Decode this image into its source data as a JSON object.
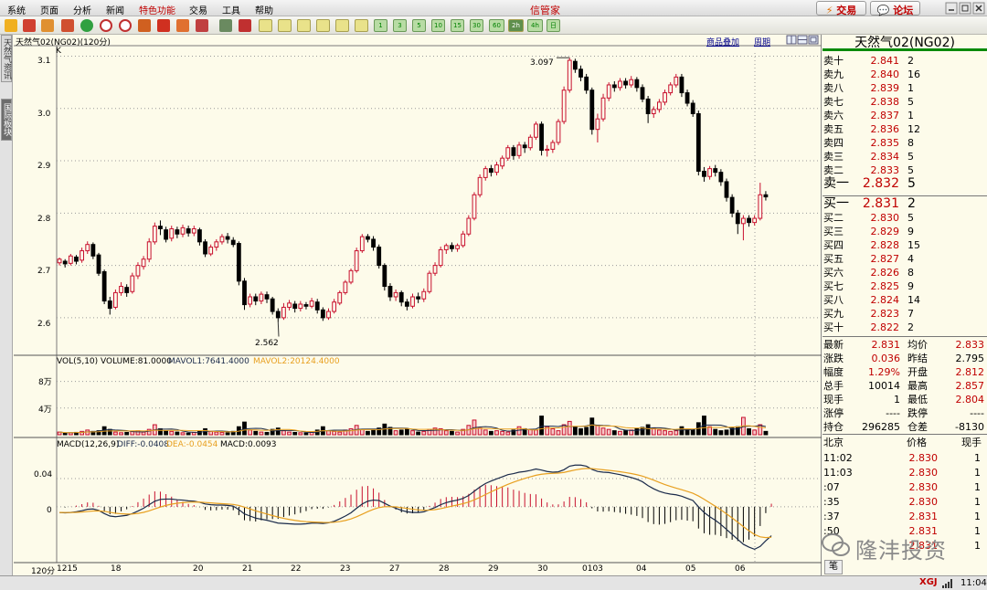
{
  "menu": {
    "items": [
      "系统",
      "页面",
      "分析",
      "新闻",
      "特色功能",
      "交易",
      "工具",
      "帮助"
    ],
    "special_index": 4
  },
  "app_title": "信管家",
  "trade_button": "交易",
  "forum_button": "论坛",
  "toolbar": {
    "periods": [
      "1",
      "3",
      "5",
      "10",
      "15",
      "30",
      "60",
      "2h",
      "4h",
      "日"
    ],
    "active_period": "2h"
  },
  "left_tabs": [
    "天然气资讯",
    "国际板块"
  ],
  "chart_header": {
    "title": "天然气02(NG02)(120分)",
    "overlay_button": "商品叠加",
    "period_button": "周期"
  },
  "main_chart": {
    "kline_label": "K",
    "yticks": [
      "3.1",
      "3.0",
      "2.9",
      "2.8",
      "2.7",
      "2.6"
    ],
    "high_label": "3.097",
    "low_label": "2.562"
  },
  "volume_panel": {
    "label": "VOL(5,10)",
    "volume": "VOLUME:81.0000",
    "mavol1": "MAVOL1:7641.4000",
    "mavol2": "MAVOL2:20124.4000",
    "yticks": [
      "8万",
      "4万"
    ]
  },
  "macd_panel": {
    "label": "MACD(12,26,9)",
    "diff": "DIFF:-0.0408",
    "dea": "DEA:-0.0454",
    "macd": "MACD:0.0093",
    "yticks": [
      "0.04",
      "0"
    ]
  },
  "xaxis": {
    "period_label": "120分",
    "dates": [
      "1215",
      "18",
      "20",
      "21",
      "22",
      "23",
      "27",
      "28",
      "29",
      "30",
      "0103",
      "04",
      "05",
      "06"
    ]
  },
  "chart_data": {
    "type": "candlestick",
    "ylim": [
      2.53,
      3.12
    ],
    "candles": [
      [
        2.705,
        2.712,
        2.7,
        2.715
      ],
      [
        2.708,
        2.703,
        2.696,
        2.712
      ],
      [
        2.704,
        2.718,
        2.7,
        2.722
      ],
      [
        2.716,
        2.708,
        2.702,
        2.72
      ],
      [
        2.71,
        2.728,
        2.705,
        2.734
      ],
      [
        2.728,
        2.74,
        2.722,
        2.746
      ],
      [
        2.74,
        2.718,
        2.712,
        2.744
      ],
      [
        2.72,
        2.685,
        2.68,
        2.724
      ],
      [
        2.688,
        2.632,
        2.626,
        2.692
      ],
      [
        2.632,
        2.618,
        2.606,
        2.64
      ],
      [
        2.62,
        2.648,
        2.616,
        2.654
      ],
      [
        2.648,
        2.66,
        2.642,
        2.668
      ],
      [
        2.658,
        2.648,
        2.64,
        2.664
      ],
      [
        2.65,
        2.68,
        2.646,
        2.686
      ],
      [
        2.68,
        2.7,
        2.674,
        2.706
      ],
      [
        2.698,
        2.712,
        2.692,
        2.718
      ],
      [
        2.712,
        2.745,
        2.706,
        2.752
      ],
      [
        2.745,
        2.775,
        2.74,
        2.782
      ],
      [
        2.775,
        2.77,
        2.758,
        2.786
      ],
      [
        2.768,
        2.75,
        2.744,
        2.774
      ],
      [
        2.752,
        2.77,
        2.746,
        2.776
      ],
      [
        2.768,
        2.76,
        2.752,
        2.774
      ],
      [
        2.76,
        2.772,
        2.754,
        2.778
      ],
      [
        2.77,
        2.762,
        2.755,
        2.776
      ],
      [
        2.762,
        2.77,
        2.756,
        2.776
      ],
      [
        2.768,
        2.745,
        2.738,
        2.772
      ],
      [
        2.745,
        2.722,
        2.716,
        2.75
      ],
      [
        2.722,
        2.735,
        2.718,
        2.74
      ],
      [
        2.735,
        2.745,
        2.728,
        2.75
      ],
      [
        2.745,
        2.755,
        2.74,
        2.76
      ],
      [
        2.755,
        2.75,
        2.742,
        2.762
      ],
      [
        2.748,
        2.74,
        2.735,
        2.754
      ],
      [
        2.742,
        2.67,
        2.662,
        2.746
      ],
      [
        2.67,
        2.625,
        2.615,
        2.676
      ],
      [
        2.626,
        2.64,
        2.62,
        2.646
      ],
      [
        2.64,
        2.632,
        2.624,
        2.646
      ],
      [
        2.632,
        2.645,
        2.626,
        2.65
      ],
      [
        2.644,
        2.636,
        2.628,
        2.65
      ],
      [
        2.636,
        2.612,
        2.606,
        2.64
      ],
      [
        2.612,
        2.6,
        2.592,
        2.618
      ],
      [
        2.6,
        2.62,
        2.596,
        2.628
      ],
      [
        2.62,
        2.628,
        2.614,
        2.634
      ],
      [
        2.626,
        2.618,
        2.61,
        2.632
      ],
      [
        2.618,
        2.626,
        2.612,
        2.632
      ],
      [
        2.625,
        2.622,
        2.616,
        2.63
      ],
      [
        2.622,
        2.632,
        2.618,
        2.638
      ],
      [
        2.63,
        2.615,
        2.608,
        2.636
      ],
      [
        2.615,
        2.6,
        2.594,
        2.62
      ],
      [
        2.6,
        2.612,
        2.596,
        2.618
      ],
      [
        2.612,
        2.63,
        2.608,
        2.636
      ],
      [
        2.628,
        2.648,
        2.624,
        2.652
      ],
      [
        2.648,
        2.668,
        2.644,
        2.672
      ],
      [
        2.668,
        2.69,
        2.664,
        2.694
      ],
      [
        2.69,
        2.728,
        2.686,
        2.734
      ],
      [
        2.728,
        2.755,
        2.724,
        2.76
      ],
      [
        2.755,
        2.75,
        2.744,
        2.76
      ],
      [
        2.75,
        2.735,
        2.728,
        2.756
      ],
      [
        2.735,
        2.7,
        2.694,
        2.74
      ],
      [
        2.7,
        2.66,
        2.652,
        2.704
      ],
      [
        2.66,
        2.64,
        2.632,
        2.666
      ],
      [
        2.64,
        2.648,
        2.632,
        2.654
      ],
      [
        2.648,
        2.63,
        2.622,
        2.652
      ],
      [
        2.63,
        2.622,
        2.614,
        2.636
      ],
      [
        2.622,
        2.64,
        2.618,
        2.646
      ],
      [
        2.64,
        2.636,
        2.628,
        2.648
      ],
      [
        2.636,
        2.65,
        2.63,
        2.656
      ],
      [
        2.65,
        2.685,
        2.646,
        2.69
      ],
      [
        2.685,
        2.7,
        2.68,
        2.706
      ],
      [
        2.7,
        2.73,
        2.696,
        2.736
      ],
      [
        2.73,
        2.738,
        2.722,
        2.742
      ],
      [
        2.738,
        2.732,
        2.726,
        2.744
      ],
      [
        2.732,
        2.738,
        2.726,
        2.742
      ],
      [
        2.738,
        2.76,
        2.734,
        2.766
      ],
      [
        2.76,
        2.79,
        2.756,
        2.796
      ],
      [
        2.79,
        2.835,
        2.786,
        2.84
      ],
      [
        2.835,
        2.868,
        2.83,
        2.874
      ],
      [
        2.868,
        2.885,
        2.862,
        2.89
      ],
      [
        2.885,
        2.878,
        2.87,
        2.892
      ],
      [
        2.878,
        2.892,
        2.872,
        2.898
      ],
      [
        2.89,
        2.905,
        2.884,
        2.91
      ],
      [
        2.905,
        2.925,
        2.9,
        2.93
      ],
      [
        2.925,
        2.91,
        2.902,
        2.93
      ],
      [
        2.91,
        2.93,
        2.904,
        2.936
      ],
      [
        2.93,
        2.925,
        2.915,
        2.936
      ],
      [
        2.925,
        2.945,
        2.92,
        2.95
      ],
      [
        2.945,
        2.97,
        2.94,
        2.975
      ],
      [
        2.97,
        2.92,
        2.91,
        2.975
      ],
      [
        2.92,
        2.922,
        2.908,
        2.93
      ],
      [
        2.922,
        2.935,
        2.915,
        2.94
      ],
      [
        2.935,
        2.975,
        2.93,
        2.98
      ],
      [
        2.975,
        3.035,
        2.97,
        3.042
      ],
      [
        3.035,
        3.092,
        3.03,
        3.097
      ],
      [
        3.09,
        3.075,
        3.068,
        3.095
      ],
      [
        3.075,
        3.06,
        3.052,
        3.082
      ],
      [
        3.06,
        3.035,
        3.028,
        3.066
      ],
      [
        3.035,
        2.96,
        2.95,
        3.04
      ],
      [
        2.96,
        2.98,
        2.935,
        2.99
      ],
      [
        2.98,
        3.02,
        2.975,
        3.028
      ],
      [
        3.02,
        3.045,
        3.014,
        3.05
      ],
      [
        3.045,
        3.04,
        3.032,
        3.052
      ],
      [
        3.04,
        3.052,
        3.034,
        3.058
      ],
      [
        3.052,
        3.045,
        3.038,
        3.058
      ],
      [
        3.045,
        3.055,
        3.04,
        3.062
      ],
      [
        3.055,
        3.04,
        3.032,
        3.06
      ],
      [
        3.04,
        3.018,
        3.012,
        3.046
      ],
      [
        3.018,
        2.99,
        2.972,
        3.024
      ],
      [
        2.99,
        2.998,
        2.982,
        3.004
      ],
      [
        2.998,
        3.012,
        2.992,
        3.018
      ],
      [
        3.012,
        3.03,
        3.006,
        3.036
      ],
      [
        3.03,
        3.045,
        3.025,
        3.05
      ],
      [
        3.045,
        3.06,
        3.04,
        3.066
      ],
      [
        3.06,
        3.03,
        3.022,
        3.066
      ],
      [
        3.03,
        3.01,
        3.004,
        3.036
      ],
      [
        3.01,
        2.99,
        2.984,
        3.016
      ],
      [
        2.99,
        2.88,
        2.872,
        2.996
      ],
      [
        2.88,
        2.87,
        2.86,
        2.888
      ],
      [
        2.87,
        2.885,
        2.864,
        2.89
      ],
      [
        2.885,
        2.878,
        2.87,
        2.892
      ],
      [
        2.878,
        2.86,
        2.852,
        2.884
      ],
      [
        2.86,
        2.83,
        2.822,
        2.866
      ],
      [
        2.83,
        2.8,
        2.792,
        2.836
      ],
      [
        2.8,
        2.78,
        2.76,
        2.806
      ],
      [
        2.78,
        2.79,
        2.748,
        2.796
      ],
      [
        2.79,
        2.782,
        2.774,
        2.796
      ],
      [
        2.782,
        2.79,
        2.776,
        2.796
      ],
      [
        2.79,
        2.835,
        2.786,
        2.858
      ],
      [
        2.835,
        2.831,
        2.824,
        2.842
      ]
    ],
    "volume": {
      "ylim": [
        0,
        100000
      ],
      "values": [
        4000,
        2500,
        3000,
        3500,
        5000,
        7000,
        5000,
        6000,
        12000,
        8000,
        4000,
        3000,
        3500,
        5000,
        6000,
        4000,
        8000,
        15000,
        9000,
        6000,
        5000,
        4000,
        3000,
        2500,
        3500,
        6000,
        9000,
        5000,
        4000,
        3500,
        3000,
        5000,
        12000,
        19000,
        7000,
        5000,
        4000,
        3500,
        8000,
        10000,
        6000,
        4000,
        3500,
        3000,
        2500,
        4000,
        7000,
        12000,
        6000,
        5000,
        4000,
        7000,
        9000,
        14000,
        8000,
        5000,
        7000,
        10000,
        16000,
        11000,
        6000,
        7000,
        9000,
        6000,
        4000,
        5000,
        8000,
        10000,
        9000,
        6000,
        5000,
        4000,
        8000,
        14000,
        22000,
        10000,
        7000,
        5000,
        6000,
        5000,
        4000,
        7000,
        12000,
        9000,
        8000,
        7000,
        28000,
        12000,
        9000,
        6000,
        15000,
        20000,
        12000,
        9000,
        11000,
        25000,
        14000,
        10000,
        8000,
        6000,
        5000,
        6000,
        7000,
        9000,
        11000,
        15000,
        10000,
        7000,
        6000,
        5000,
        6000,
        12000,
        8000,
        7000,
        18000,
        28000,
        12000,
        8000,
        6000,
        7000,
        10000,
        12000,
        26000,
        9000,
        7000,
        15000,
        5000
      ]
    },
    "macd": {
      "ylim": [
        -0.075,
        0.08
      ],
      "diff": [
        -0.008,
        -0.0085,
        -0.008,
        -0.007,
        -0.0055,
        -0.0035,
        -0.003,
        -0.005,
        -0.0095,
        -0.013,
        -0.014,
        -0.013,
        -0.012,
        -0.0095,
        -0.006,
        -0.002,
        0.003,
        0.008,
        0.0105,
        0.011,
        0.011,
        0.01,
        0.0095,
        0.0085,
        0.008,
        0.0065,
        0.004,
        0.003,
        0.0025,
        0.0025,
        0.002,
        0.001,
        -0.004,
        -0.01,
        -0.013,
        -0.016,
        -0.0175,
        -0.019,
        -0.021,
        -0.023,
        -0.0235,
        -0.024,
        -0.0245,
        -0.0245,
        -0.024,
        -0.023,
        -0.023,
        -0.0235,
        -0.0225,
        -0.0205,
        -0.017,
        -0.013,
        -0.0085,
        -0.002,
        0.004,
        0.008,
        0.0095,
        0.009,
        0.005,
        0.001,
        -0.002,
        -0.005,
        -0.007,
        -0.008,
        -0.008,
        -0.007,
        -0.004,
        -0.001,
        0.003,
        0.006,
        0.008,
        0.0095,
        0.012,
        0.016,
        0.022,
        0.028,
        0.033,
        0.0365,
        0.0395,
        0.0425,
        0.0455,
        0.047,
        0.049,
        0.05,
        0.0515,
        0.0535,
        0.052,
        0.05,
        0.049,
        0.0495,
        0.0525,
        0.0575,
        0.059,
        0.059,
        0.0575,
        0.053,
        0.05,
        0.049,
        0.0485,
        0.047,
        0.0455,
        0.0435,
        0.0415,
        0.039,
        0.0355,
        0.03,
        0.0255,
        0.022,
        0.0195,
        0.018,
        0.017,
        0.015,
        0.012,
        0.009,
        0.0,
        -0.008,
        -0.014,
        -0.019,
        -0.025,
        -0.032,
        -0.039,
        -0.046,
        -0.053,
        -0.057,
        -0.06,
        -0.056,
        -0.048,
        -0.0408
      ]
    }
  },
  "quote_panel": {
    "title": "天然气02(NG02)",
    "asks": [
      {
        "label": "卖十",
        "price": "2.841",
        "vol": "2"
      },
      {
        "label": "卖九",
        "price": "2.840",
        "vol": "16"
      },
      {
        "label": "卖八",
        "price": "2.839",
        "vol": "1"
      },
      {
        "label": "卖七",
        "price": "2.838",
        "vol": "5"
      },
      {
        "label": "卖六",
        "price": "2.837",
        "vol": "1"
      },
      {
        "label": "卖五",
        "price": "2.836",
        "vol": "12"
      },
      {
        "label": "卖四",
        "price": "2.835",
        "vol": "8"
      },
      {
        "label": "卖三",
        "price": "2.834",
        "vol": "5"
      },
      {
        "label": "卖二",
        "price": "2.833",
        "vol": "5"
      },
      {
        "label": "卖一",
        "price": "2.832",
        "vol": "5"
      }
    ],
    "bids": [
      {
        "label": "买一",
        "price": "2.831",
        "vol": "2"
      },
      {
        "label": "买二",
        "price": "2.830",
        "vol": "5"
      },
      {
        "label": "买三",
        "price": "2.829",
        "vol": "9"
      },
      {
        "label": "买四",
        "price": "2.828",
        "vol": "15"
      },
      {
        "label": "买五",
        "price": "2.827",
        "vol": "4"
      },
      {
        "label": "买六",
        "price": "2.826",
        "vol": "8"
      },
      {
        "label": "买七",
        "price": "2.825",
        "vol": "9"
      },
      {
        "label": "买八",
        "price": "2.824",
        "vol": "14"
      },
      {
        "label": "买九",
        "price": "2.823",
        "vol": "7"
      },
      {
        "label": "买十",
        "price": "2.822",
        "vol": "2"
      }
    ],
    "stats": [
      {
        "l1": "最新",
        "v1": "2.831",
        "c1": "red",
        "l2": "均价",
        "v2": "2.833",
        "c2": "red"
      },
      {
        "l1": "涨跌",
        "v1": "0.036",
        "c1": "red",
        "l2": "昨结",
        "v2": "2.795",
        "c2": ""
      },
      {
        "l1": "幅度",
        "v1": "1.29%",
        "c1": "red",
        "l2": "开盘",
        "v2": "2.812",
        "c2": "red"
      },
      {
        "l1": "总手",
        "v1": "10014",
        "c1": "",
        "l2": "最高",
        "v2": "2.857",
        "c2": "red"
      },
      {
        "l1": "现手",
        "v1": "1",
        "c1": "",
        "l2": "最低",
        "v2": "2.804",
        "c2": "red"
      },
      {
        "l1": "涨停",
        "v1": "----",
        "c1": "",
        "l2": "跌停",
        "v2": "----",
        "c2": ""
      },
      {
        "l1": "持仓",
        "v1": "296285",
        "c1": "",
        "l2": "仓差",
        "v2": "-8130",
        "c2": ""
      }
    ],
    "ticks_header": {
      "location": "北京",
      "price": "价格",
      "qty": "现手"
    },
    "ticks": [
      {
        "time": "11:02",
        "price": "2.830",
        "qty": "1"
      },
      {
        "time": "11:03",
        "price": "2.830",
        "qty": "1"
      },
      {
        "time": ":07",
        "price": "2.830",
        "qty": "1"
      },
      {
        "time": ":35",
        "price": "2.830",
        "qty": "1"
      },
      {
        "time": ":37",
        "price": "2.831",
        "qty": "1"
      },
      {
        "time": ":50",
        "price": "2.831",
        "qty": "1"
      },
      {
        "time": "",
        "price": "2.831",
        "qty": "1"
      }
    ],
    "bottom_tab": "笔"
  },
  "watermark": "隆沣投资",
  "status_bar": {
    "time": "11:04",
    "brand": "XGJ"
  },
  "colors": {
    "up": "#c8102e",
    "down": "#000000",
    "diff_line": "#1a2a4a",
    "dea_line": "#e8a020"
  }
}
